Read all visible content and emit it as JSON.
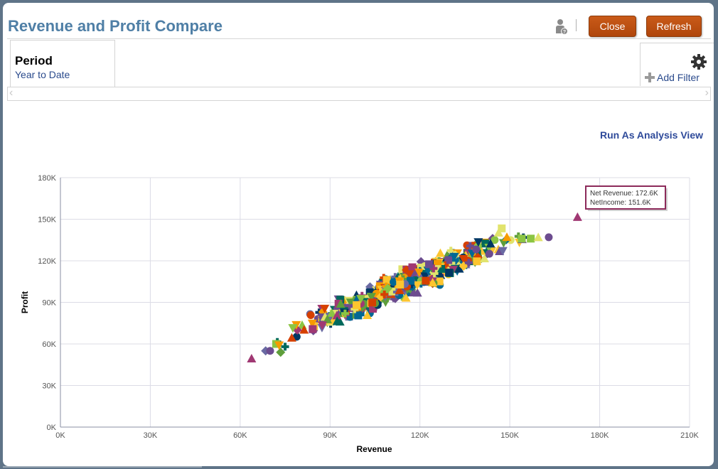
{
  "dialog": {
    "title": "Revenue and Profit Compare",
    "close_label": "Close",
    "refresh_label": "Refresh",
    "user_icon": "user-help-icon"
  },
  "prompt": {
    "label": "Period",
    "value": "Year to Date"
  },
  "filter": {
    "add_label": "Add Filter",
    "gear_icon": "gear-icon",
    "plus_icon": "plus-icon"
  },
  "scroller": {
    "left_glyph": "‹",
    "right_glyph": "›"
  },
  "links": {
    "run_as_analysis": "Run As Analysis View"
  },
  "chart_data": {
    "type": "scatter",
    "title": "",
    "xlabel": "Revenue",
    "ylabel": "Profit",
    "xlim": [
      0,
      210000
    ],
    "ylim": [
      0,
      180000
    ],
    "x_ticks": [
      0,
      30000,
      60000,
      90000,
      120000,
      150000,
      180000,
      210000
    ],
    "x_tick_labels": [
      "0K",
      "30K",
      "60K",
      "90K",
      "120K",
      "150K",
      "180K",
      "210K"
    ],
    "y_ticks": [
      0,
      30000,
      60000,
      90000,
      120000,
      150000,
      180000
    ],
    "y_tick_labels": [
      "0K",
      "30K",
      "60K",
      "90K",
      "120K",
      "150K",
      "180K"
    ],
    "grid": true,
    "legend": "none",
    "marker_colors": [
      "#003764",
      "#f79b00",
      "#8bc543",
      "#6c4c8f",
      "#a03873",
      "#00695c",
      "#e1e36d",
      "#d64000",
      "#006895",
      "#6a6aa3",
      "#fdc52f",
      "#5e9e3b"
    ],
    "marker_shapes": [
      "square",
      "circle",
      "triangle-up",
      "triangle-down",
      "diamond",
      "plus"
    ],
    "cluster": {
      "count": 520,
      "x_range": [
        70000,
        162000
      ],
      "slope": 0.95,
      "intercept": -6000,
      "spread": 4500
    },
    "points": [
      {
        "x": 63800,
        "y": 49500,
        "shape": "triangle-up",
        "color": "#a03873"
      },
      {
        "x": 68500,
        "y": 55000,
        "shape": "diamond",
        "color": "#6a6aa3"
      },
      {
        "x": 70000,
        "y": 55000,
        "shape": "circle",
        "color": "#6c4c8f"
      },
      {
        "x": 73500,
        "y": 54000,
        "shape": "diamond",
        "color": "#5e9e3b"
      },
      {
        "x": 72000,
        "y": 60000,
        "shape": "square",
        "color": "#8bc543"
      },
      {
        "x": 73000,
        "y": 59000,
        "shape": "triangle-down",
        "color": "#f79b00"
      },
      {
        "x": 75000,
        "y": 58000,
        "shape": "plus",
        "color": "#00695c"
      },
      {
        "x": 154000,
        "y": 136000,
        "shape": "square",
        "color": "#8bc543"
      },
      {
        "x": 157000,
        "y": 136000,
        "shape": "square",
        "color": "#8bc543"
      },
      {
        "x": 159500,
        "y": 137000,
        "shape": "triangle-up",
        "color": "#e1e36d"
      },
      {
        "x": 163000,
        "y": 137000,
        "shape": "circle",
        "color": "#6c4c8f"
      },
      {
        "x": 172600,
        "y": 151600,
        "shape": "triangle-up",
        "color": "#a03873"
      }
    ],
    "tooltip": {
      "lines": [
        "Net Revenue: 172.6K",
        "NetIncome: 151.6K"
      ],
      "border_color": "#8c2a5a"
    }
  }
}
